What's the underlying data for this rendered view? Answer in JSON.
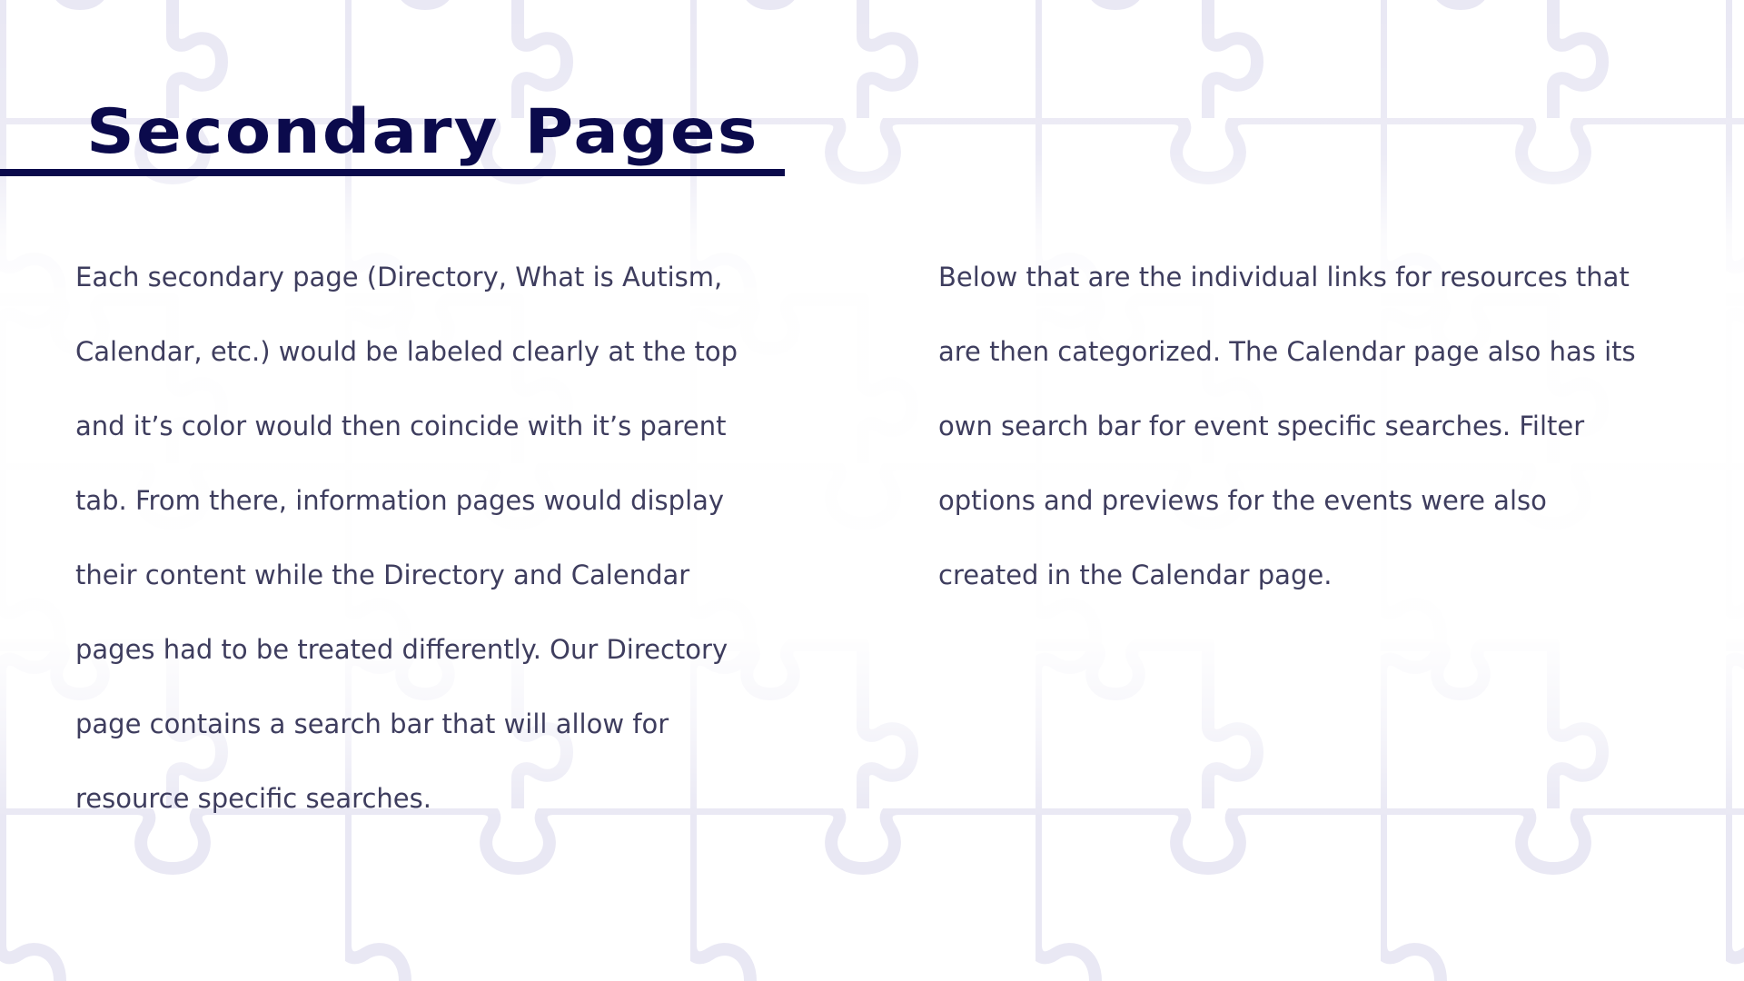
{
  "slide": {
    "title": "Secondary Pages",
    "left_column": {
      "lines": [
        "Each secondary page (Directory, What is Autism,",
        "Calendar, etc.) would be labeled clearly at the top",
        "and it’s color would then coincide with it’s parent",
        "tab. From there, information pages would display",
        "their content while the Directory and Calendar",
        "pages had to be treated differently. Our Directory",
        "page contains a search bar that will allow for",
        "resource specific searches."
      ]
    },
    "right_column": {
      "lines": [
        " Below that are the individual links for resources that",
        "are then categorized. The Calendar page also has its",
        "own search bar for event specific searches. Filter",
        "options and previews for the events were also",
        "created in the Calendar page."
      ]
    }
  },
  "colors": {
    "title": "#0b0a4c",
    "body_text": "#3e3d5e",
    "background": "#ffffff",
    "puzzle_pattern": "#e9e8f4"
  },
  "background_icon": "puzzle-pattern"
}
